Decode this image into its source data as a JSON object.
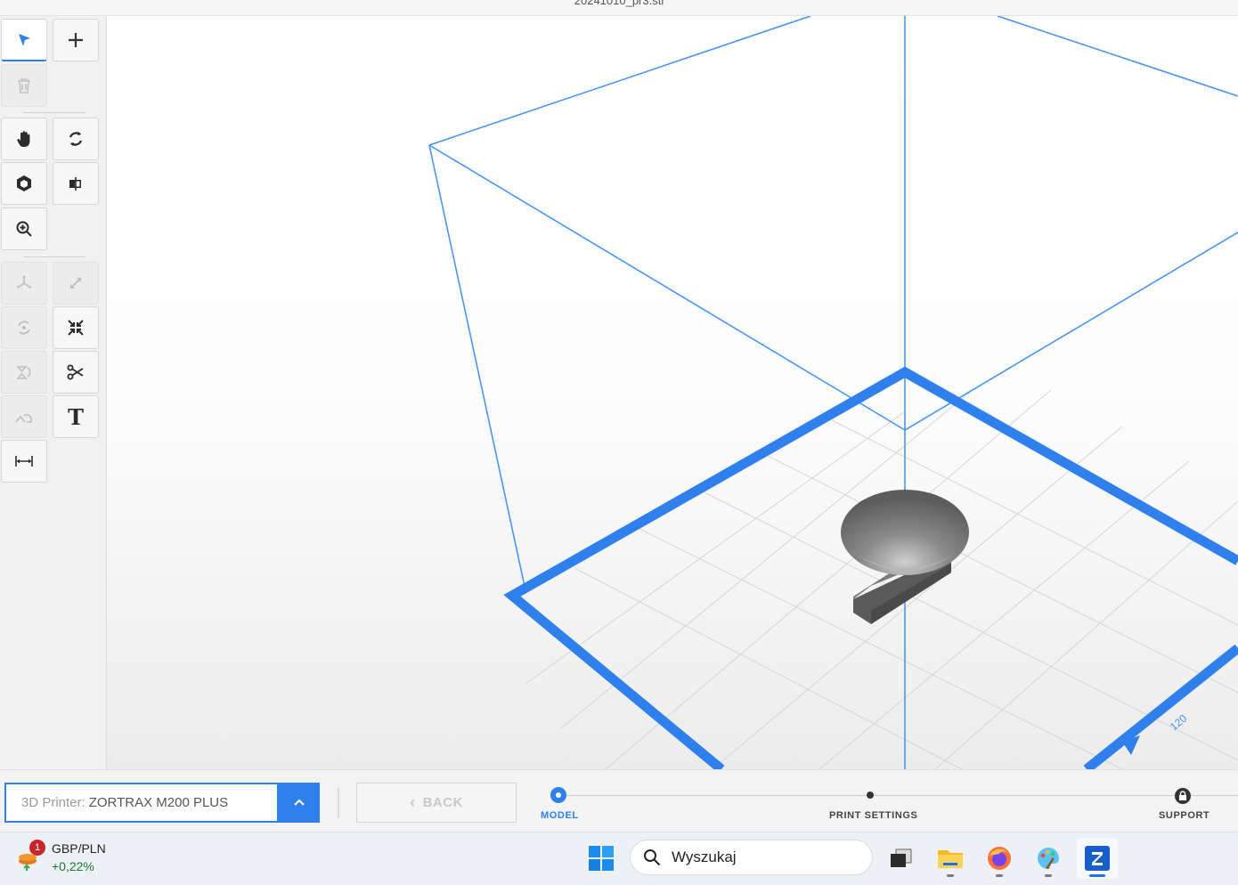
{
  "window": {
    "title": "20241010_pr3.stl"
  },
  "toolbar": {
    "tools": [
      {
        "name": "select-tool",
        "icon": "cursor-arrow-icon",
        "state": "active"
      },
      {
        "name": "add-model-button",
        "icon": "plus-icon",
        "state": "enabled"
      },
      {
        "name": "delete-button",
        "icon": "trash-icon",
        "state": "disabled"
      },
      {
        "name": "pan-tool",
        "icon": "hand-icon",
        "state": "enabled"
      },
      {
        "name": "orbit-tool",
        "icon": "orbit-icon",
        "state": "enabled"
      },
      {
        "name": "view-cube-button",
        "icon": "cube-icon",
        "state": "enabled"
      },
      {
        "name": "view-front-button",
        "icon": "view-side-icon",
        "state": "enabled"
      },
      {
        "name": "zoom-tool",
        "icon": "zoom-in-icon",
        "state": "enabled"
      },
      {
        "name": "move-tool",
        "icon": "move-icon",
        "state": "disabled"
      },
      {
        "name": "scale-tool",
        "icon": "scale-icon",
        "state": "disabled"
      },
      {
        "name": "rotate-tool",
        "icon": "rotate-icon",
        "state": "disabled"
      },
      {
        "name": "auto-arrange-button",
        "icon": "arrange-icon",
        "state": "enabled"
      },
      {
        "name": "mirror-tool",
        "icon": "mirror-icon",
        "state": "disabled"
      },
      {
        "name": "cut-tool",
        "icon": "scissors-icon",
        "state": "enabled"
      },
      {
        "name": "place-on-face-tool",
        "icon": "place-face-icon",
        "state": "disabled"
      },
      {
        "name": "text-tool",
        "icon": "text-icon",
        "state": "enabled"
      },
      {
        "name": "measure-tool",
        "icon": "measure-icon",
        "state": "enabled"
      }
    ],
    "text_tool_glyph": "T"
  },
  "viewport": {
    "axis_label": "120",
    "colors": {
      "build_volume": "#4a96f0",
      "platform": "#2f80ed",
      "grid": "#d6d6d6",
      "model": "#6e6e6e"
    }
  },
  "bottom": {
    "printer_label": "3D Printer:",
    "printer_value": "ZORTRAX M200 PLUS",
    "back_label": "BACK",
    "steps": [
      {
        "label": "MODEL",
        "state": "current"
      },
      {
        "label": "PRINT SETTINGS",
        "state": "upcoming"
      },
      {
        "label": "SUPPORT",
        "state": "locked"
      }
    ]
  },
  "taskbar": {
    "widget": {
      "badge": "1",
      "title": "GBP/PLN",
      "change": "+0,22%"
    },
    "search_placeholder": "Wyszukaj",
    "apps": [
      {
        "name": "start-menu",
        "icon": "windows-logo-icon"
      },
      {
        "name": "task-view",
        "icon": "task-view-icon"
      },
      {
        "name": "file-explorer",
        "icon": "folder-icon"
      },
      {
        "name": "firefox",
        "icon": "firefox-icon"
      },
      {
        "name": "paint",
        "icon": "paint-palette-icon"
      },
      {
        "name": "zortrax-z-suite",
        "icon": "z-suite-icon"
      }
    ]
  }
}
